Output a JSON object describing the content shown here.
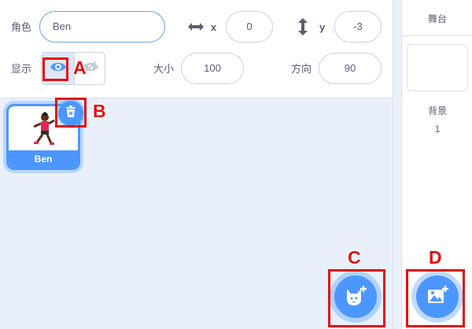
{
  "sprite_info": {
    "sprite_label": "角色",
    "sprite_name": "Ben",
    "x_label": "x",
    "x_value": "0",
    "y_label": "y",
    "y_value": "-3",
    "show_label": "显示",
    "size_label": "大小",
    "size_value": "100",
    "direction_label": "方向",
    "direction_value": "90"
  },
  "sprite_list": {
    "items": [
      {
        "name": "Ben",
        "selected": true
      }
    ]
  },
  "stage": {
    "title": "舞台",
    "backdrops_label": "背景",
    "backdrops_count": "1"
  },
  "annotations": {
    "a": "A",
    "b": "B",
    "c": "C",
    "d": "D"
  },
  "colors": {
    "accent": "#4c97ff",
    "highlight": "#e40e0e",
    "text": "#575e75"
  }
}
